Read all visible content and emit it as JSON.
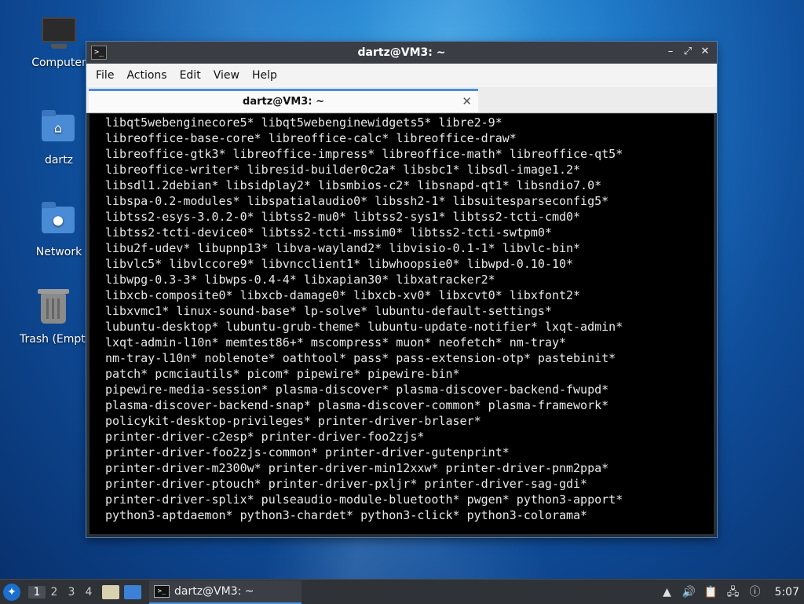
{
  "desktop": {
    "icons": [
      {
        "label": "Computer"
      },
      {
        "label": "dartz"
      },
      {
        "label": "Network"
      },
      {
        "label": "Trash (Empty)"
      }
    ]
  },
  "window": {
    "title": "dartz@VM3: ~",
    "menu": [
      "File",
      "Actions",
      "Edit",
      "View",
      "Help"
    ],
    "tab_title": "dartz@VM3: ~",
    "terminal_lines": [
      "libqt5webenginecore5* libqt5webenginewidgets5* libre2-9*",
      "libreoffice-base-core* libreoffice-calc* libreoffice-draw*",
      "libreoffice-gtk3* libreoffice-impress* libreoffice-math* libreoffice-qt5*",
      "libreoffice-writer* libresid-builder0c2a* libsbc1* libsdl-image1.2*",
      "libsdl1.2debian* libsidplay2* libsmbios-c2* libsnapd-qt1* libsndio7.0*",
      "libspa-0.2-modules* libspatialaudio0* libssh2-1* libsuitesparseconfig5*",
      "libtss2-esys-3.0.2-0* libtss2-mu0* libtss2-sys1* libtss2-tcti-cmd0*",
      "libtss2-tcti-device0* libtss2-tcti-mssim0* libtss2-tcti-swtpm0*",
      "libu2f-udev* libupnp13* libva-wayland2* libvisio-0.1-1* libvlc-bin*",
      "libvlc5* libvlccore9* libvncclient1* libwhoopsie0* libwpd-0.10-10*",
      "libwpg-0.3-3* libwps-0.4-4* libxapian30* libxatracker2*",
      "libxcb-composite0* libxcb-damage0* libxcb-xv0* libxcvt0* libxfont2*",
      "libxvmc1* linux-sound-base* lp-solve* lubuntu-default-settings*",
      "lubuntu-desktop* lubuntu-grub-theme* lubuntu-update-notifier* lxqt-admin*",
      "lxqt-admin-l10n* memtest86+* mscompress* muon* neofetch* nm-tray*",
      "nm-tray-l10n* noblenote* oathtool* pass* pass-extension-otp* pastebinit*",
      "patch* pcmciautils* picom* pipewire* pipewire-bin*",
      "pipewire-media-session* plasma-discover* plasma-discover-backend-fwupd*",
      "plasma-discover-backend-snap* plasma-discover-common* plasma-framework*",
      "policykit-desktop-privileges* printer-driver-brlaser*",
      "printer-driver-c2esp* printer-driver-foo2zjs*",
      "printer-driver-foo2zjs-common* printer-driver-gutenprint*",
      "printer-driver-m2300w* printer-driver-min12xxw* printer-driver-pnm2ppa*",
      "printer-driver-ptouch* printer-driver-pxljr* printer-driver-sag-gdi*",
      "printer-driver-splix* pulseaudio-module-bluetooth* pwgen* python3-apport*",
      "python3-aptdaemon* python3-chardet* python3-click* python3-colorama*"
    ]
  },
  "taskbar": {
    "workspaces": [
      "1",
      "2",
      "3",
      "4"
    ],
    "task_label": "dartz@VM3: ~",
    "clock": "5:07"
  }
}
